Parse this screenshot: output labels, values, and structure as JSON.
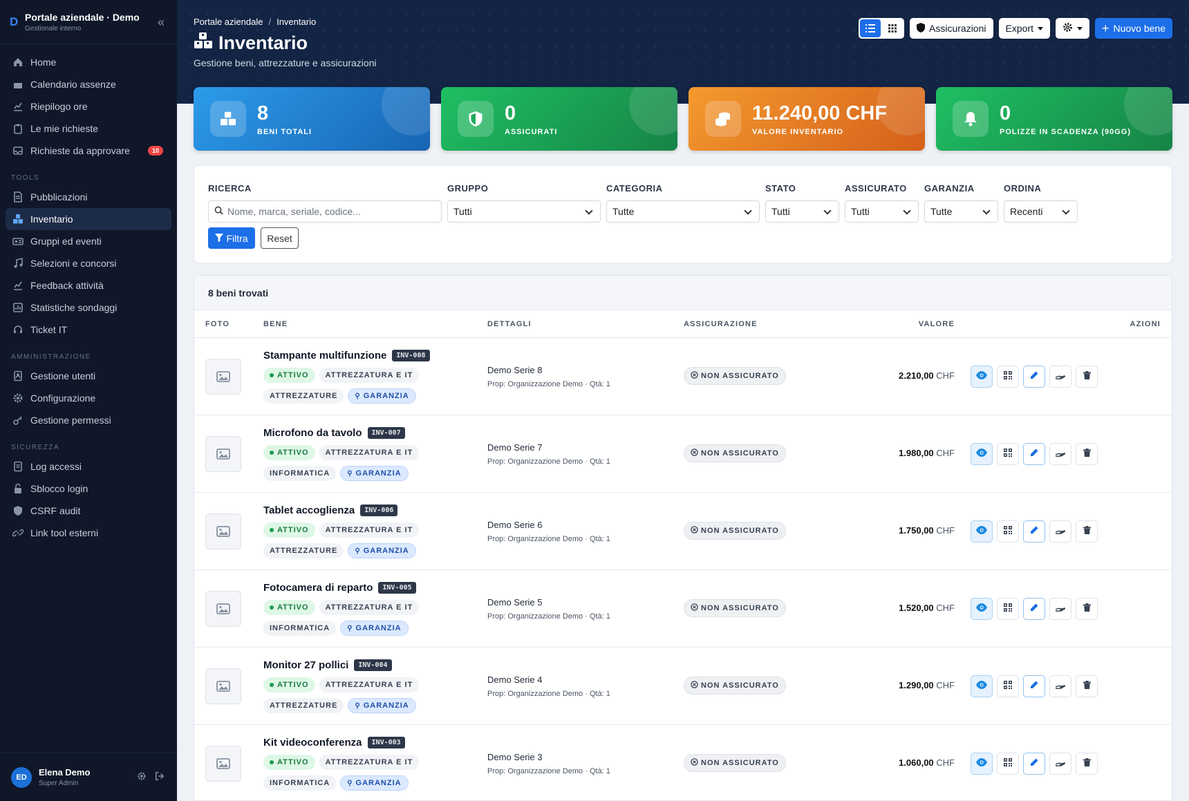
{
  "app": {
    "title": "Portale aziendale · Demo",
    "subtitle": "Gestionale interno",
    "logo_letter": "D"
  },
  "sidebar": {
    "main_items": [
      {
        "label": "Home",
        "icon": "home-icon"
      },
      {
        "label": "Calendario assenze",
        "icon": "calendar-icon"
      },
      {
        "label": "Riepilogo ore",
        "icon": "chart-icon"
      },
      {
        "label": "Le mie richieste",
        "icon": "clipboard-icon"
      },
      {
        "label": "Richieste da approvare",
        "icon": "inbox-icon",
        "badge": "10"
      }
    ],
    "tools_title": "TOOLS",
    "tools_items": [
      {
        "label": "Pubblicazioni",
        "icon": "document-icon"
      },
      {
        "label": "Inventario",
        "icon": "boxes-icon",
        "active": true
      },
      {
        "label": "Gruppi ed eventi",
        "icon": "group-icon"
      },
      {
        "label": "Selezioni e concorsi",
        "icon": "music-icon"
      },
      {
        "label": "Feedback attività",
        "icon": "chart-line-icon"
      },
      {
        "label": "Statistiche sondaggi",
        "icon": "poll-icon"
      },
      {
        "label": "Ticket IT",
        "icon": "headset-icon"
      }
    ],
    "admin_title": "AMMINISTRAZIONE",
    "admin_items": [
      {
        "label": "Gestione utenti",
        "icon": "users-icon"
      },
      {
        "label": "Configurazione",
        "icon": "gear-icon"
      },
      {
        "label": "Gestione permessi",
        "icon": "key-icon"
      }
    ],
    "security_title": "SICUREZZA",
    "security_items": [
      {
        "label": "Log accessi",
        "icon": "log-icon"
      },
      {
        "label": "Sblocco login",
        "icon": "unlock-icon"
      },
      {
        "label": "CSRF audit",
        "icon": "shield-icon"
      },
      {
        "label": "Link tool esterni",
        "icon": "link-icon"
      }
    ],
    "user": {
      "initials": "ED",
      "name": "Elena Demo",
      "role": "Super Admin"
    }
  },
  "breadcrumb": {
    "root": "Portale aziendale",
    "current": "Inventario"
  },
  "page": {
    "title": "Inventario",
    "subtitle": "Gestione beni, attrezzature e assicurazioni"
  },
  "toolbar": {
    "insurance": "Assicurazioni",
    "export": "Export",
    "new_item": "Nuovo bene"
  },
  "stats": [
    {
      "value": "8",
      "label": "BENI TOTALI"
    },
    {
      "value": "0",
      "label": "ASSICURATI"
    },
    {
      "value": "11.240,00 CHF",
      "label": "VALORE INVENTARIO"
    },
    {
      "value": "0",
      "label": "POLIZZE IN SCADENZA (90GG)"
    }
  ],
  "filters": {
    "search_label": "RICERCA",
    "search_placeholder": "Nome, marca, seriale, codice...",
    "group_label": "GRUPPO",
    "group_value": "Tutti",
    "category_label": "CATEGORIA",
    "category_value": "Tutte",
    "status_label": "STATO",
    "status_value": "Tutti",
    "insured_label": "ASSICURATO",
    "insured_value": "Tutti",
    "warranty_label": "GARANZIA",
    "warranty_value": "Tutte",
    "order_label": "ORDINA",
    "order_value": "Recenti",
    "filter_button": "Filtra",
    "reset_button": "Reset"
  },
  "table": {
    "found": "8 beni trovati",
    "columns": {
      "photo": "FOTO",
      "item": "BENE",
      "details": "DETTAGLI",
      "insurance": "ASSICURAZIONE",
      "value": "VALORE",
      "actions": "AZIONI"
    },
    "rows": [
      {
        "name": "Stampante multifunzione",
        "code": "INV-008",
        "status": "ATTIVO",
        "group": "ATTREZZATURA E IT",
        "category": "ATTREZZATURE",
        "warranty": "GARANZIA",
        "serial": "Demo Serie 8",
        "owner": "Prop: Organizzazione Demo · Qtà: 1",
        "insurance": "NON ASSICURATO",
        "amount": "2.210,00",
        "currency": "CHF"
      },
      {
        "name": "Microfono da tavolo",
        "code": "INV-007",
        "status": "ATTIVO",
        "group": "ATTREZZATURA E IT",
        "category": "INFORMATICA",
        "warranty": "GARANZIA",
        "serial": "Demo Serie 7",
        "owner": "Prop: Organizzazione Demo · Qtà: 1",
        "insurance": "NON ASSICURATO",
        "amount": "1.980,00",
        "currency": "CHF"
      },
      {
        "name": "Tablet accoglienza",
        "code": "INV-006",
        "status": "ATTIVO",
        "group": "ATTREZZATURA E IT",
        "category": "ATTREZZATURE",
        "warranty": "GARANZIA",
        "serial": "Demo Serie 6",
        "owner": "Prop: Organizzazione Demo · Qtà: 1",
        "insurance": "NON ASSICURATO",
        "amount": "1.750,00",
        "currency": "CHF"
      },
      {
        "name": "Fotocamera di reparto",
        "code": "INV-005",
        "status": "ATTIVO",
        "group": "ATTREZZATURA E IT",
        "category": "INFORMATICA",
        "warranty": "GARANZIA",
        "serial": "Demo Serie 5",
        "owner": "Prop: Organizzazione Demo · Qtà: 1",
        "insurance": "NON ASSICURATO",
        "amount": "1.520,00",
        "currency": "CHF"
      },
      {
        "name": "Monitor 27 pollici",
        "code": "INV-004",
        "status": "ATTIVO",
        "group": "ATTREZZATURA E IT",
        "category": "ATTREZZATURE",
        "warranty": "GARANZIA",
        "serial": "Demo Serie 4",
        "owner": "Prop: Organizzazione Demo · Qtà: 1",
        "insurance": "NON ASSICURATO",
        "amount": "1.290,00",
        "currency": "CHF"
      },
      {
        "name": "Kit videoconferenza",
        "code": "INV-003",
        "status": "ATTIVO",
        "group": "ATTREZZATURA E IT",
        "category": "INFORMATICA",
        "warranty": "GARANZIA",
        "serial": "Demo Serie 3",
        "owner": "Prop: Organizzazione Demo · Qtà: 1",
        "insurance": "NON ASSICURATO",
        "amount": "1.060,00",
        "currency": "CHF"
      }
    ]
  }
}
